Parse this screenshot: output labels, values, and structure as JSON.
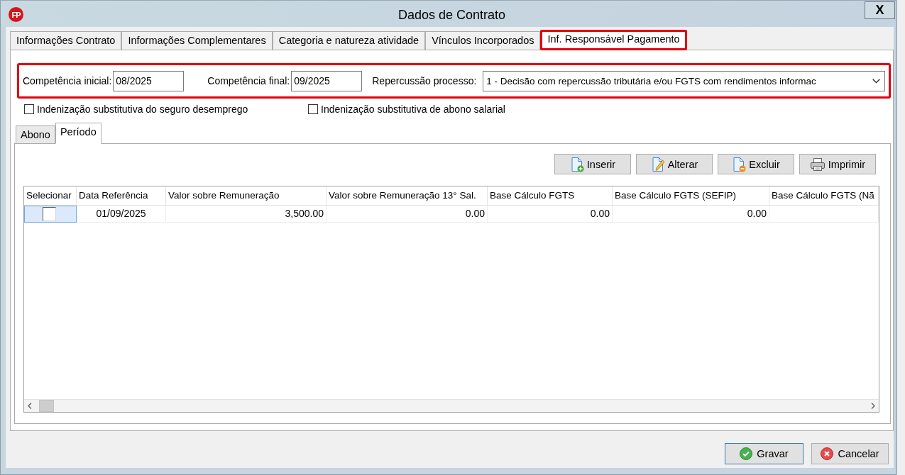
{
  "window": {
    "logo": "FP",
    "title": "Dados de Contrato",
    "close": "X"
  },
  "tabs": [
    {
      "label": "Informações Contrato",
      "selected": false,
      "highlighted": false
    },
    {
      "label": "Informações Complementares",
      "selected": false,
      "highlighted": false
    },
    {
      "label": "Categoria e natureza atividade",
      "selected": false,
      "highlighted": false
    },
    {
      "label": "Vínculos Incorporados",
      "selected": false,
      "highlighted": false
    },
    {
      "label": "Inf. Responsável Pagamento",
      "selected": true,
      "highlighted": true
    }
  ],
  "filter": {
    "highlighted": true,
    "fields": [
      {
        "kind": "input",
        "label": "Competência inicial:",
        "value": "08/2025"
      },
      {
        "kind": "input",
        "label": "Competência final:",
        "value": "09/2025"
      },
      {
        "kind": "select",
        "label": "Repercussão processo:",
        "value": "1 - Decisão com repercussão tributária e/ou FGTS com rendimentos informac"
      }
    ]
  },
  "checkboxes": [
    {
      "label": "Indenização substitutiva do seguro desemprego",
      "checked": false
    },
    {
      "label": "Indenização substitutiva de abono salarial",
      "checked": false
    }
  ],
  "sub_tabs": [
    {
      "label": "Abono",
      "selected": false
    },
    {
      "label": "Período",
      "selected": true
    }
  ],
  "toolbar": [
    {
      "label": "Inserir"
    },
    {
      "label": "Alterar"
    },
    {
      "label": "Excluir"
    },
    {
      "label": "Imprimir"
    }
  ],
  "table": {
    "columns": [
      {
        "label": "Selecionar",
        "kind": "check"
      },
      {
        "label": "Data Referência",
        "kind": "date"
      },
      {
        "label": "Valor sobre Remuneração",
        "kind": "money"
      },
      {
        "label": "Valor sobre Remuneração 13° Sal.",
        "kind": "money"
      },
      {
        "label": "Base Cálculo FGTS",
        "kind": "money"
      },
      {
        "label": "Base Cálculo FGTS (SEFIP)",
        "kind": "money"
      },
      {
        "label": "Base Cálculo FGTS (Nã",
        "kind": "money"
      }
    ],
    "rows": [
      {
        "checked": false,
        "focused": true,
        "cells": [
          "",
          "01/09/2025",
          "3,500.00",
          "0.00",
          "0.00",
          "0.00"
        ]
      }
    ]
  },
  "footer_buttons": [
    {
      "label": "Gravar",
      "default": true
    },
    {
      "label": "Cancelar",
      "default": false
    }
  ]
}
